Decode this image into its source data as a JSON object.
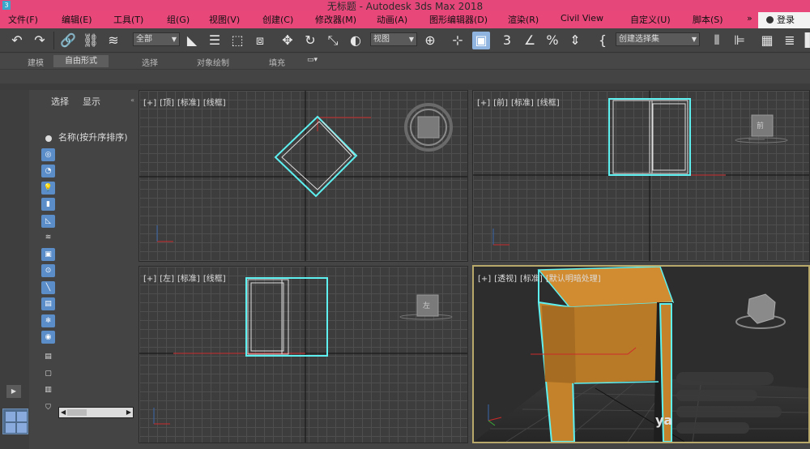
{
  "window": {
    "title": "无标题 - Autodesk 3ds Max 2018",
    "app_icon_label": "3"
  },
  "menu": {
    "items": [
      {
        "label": "文件(F)"
      },
      {
        "label": "编辑(E)"
      },
      {
        "label": "工具(T)"
      },
      {
        "label": "组(G)"
      },
      {
        "label": "视图(V)"
      },
      {
        "label": "创建(C)"
      },
      {
        "label": "修改器(M)"
      },
      {
        "label": "动画(A)"
      },
      {
        "label": "图形编辑器(D)"
      },
      {
        "label": "渲染(R)"
      },
      {
        "label": "Civil View"
      },
      {
        "label": "自定义(U)"
      },
      {
        "label": "脚本(S)"
      }
    ],
    "more_label": "»",
    "login_label": "登录"
  },
  "toolbar": {
    "icons": {
      "undo": "↶",
      "redo": "↷",
      "link": "🔗",
      "unlink": "⛓",
      "bind": "≋",
      "select": "◣",
      "select_by_name": "☰",
      "rect_region": "⬚",
      "window_crossing": "⧈",
      "move": "✥",
      "rotate": "↻",
      "scale": "⤡",
      "placement": "◐",
      "pivot": "⊕",
      "snap_toggle": "⊹",
      "manipulate": "▣",
      "snap3": "3",
      "angle_snap": "∠",
      "percent_snap": "%",
      "spinner_snap": "⇕",
      "edit_named": "{",
      "mirror": "⫴",
      "align": "⊫",
      "layers": "▦",
      "ribbon_toggle": "≣",
      "extra": "▌"
    },
    "selection_filter": "全部",
    "reference_coord": "视图",
    "named_selection_placeholder": "创建选择集"
  },
  "ribbon": {
    "tabs": [
      {
        "label": "建模",
        "active": false
      },
      {
        "label": "自由形式",
        "active": true
      },
      {
        "label": "选择",
        "active": false
      },
      {
        "label": "对象绘制",
        "active": false
      },
      {
        "label": "填充",
        "active": false
      }
    ],
    "dropdown_icon": "▭▾"
  },
  "scene_explorer": {
    "tabs": [
      {
        "label": "选择"
      },
      {
        "label": "显示"
      }
    ],
    "column_header": "名称(按升序排序)",
    "collapse_icon": "«",
    "filters": [
      {
        "name": "geometry-filter-icon",
        "glyph": "◎",
        "on": true
      },
      {
        "name": "shape-filter-icon",
        "glyph": "◔",
        "on": true
      },
      {
        "name": "light-filter-icon",
        "glyph": "💡",
        "on": true
      },
      {
        "name": "camera-filter-icon",
        "glyph": "▮",
        "on": true
      },
      {
        "name": "helper-filter-icon",
        "glyph": "◺",
        "on": true
      },
      {
        "name": "spacewarp-filter-icon",
        "glyph": "≋",
        "on": false
      },
      {
        "name": "group-filter-icon",
        "glyph": "▣",
        "on": true
      },
      {
        "name": "xref-filter-icon",
        "glyph": "⊙",
        "on": true
      },
      {
        "name": "bone-filter-icon",
        "glyph": "╲",
        "on": true
      },
      {
        "name": "container-filter-icon",
        "glyph": "▤",
        "on": true
      },
      {
        "name": "particle-filter-icon",
        "glyph": "❄",
        "on": true
      },
      {
        "name": "hidden-filter-icon",
        "glyph": "◉",
        "on": true
      },
      {
        "name": "list-a-icon",
        "glyph": "▤",
        "on": false
      },
      {
        "name": "list-b-icon",
        "glyph": "▢",
        "on": false
      },
      {
        "name": "list-c-icon",
        "glyph": "▥",
        "on": false
      },
      {
        "name": "filter-funnel-icon",
        "glyph": "⛉",
        "on": false
      }
    ],
    "expand_icon": "▶"
  },
  "viewports": {
    "top": {
      "labels": [
        "[+]",
        "[顶]",
        "[标准]",
        "[线框]"
      ]
    },
    "front": {
      "labels": [
        "[+]",
        "[前]",
        "[标准]",
        "[线框]"
      ],
      "viewcube_face": "前"
    },
    "left": {
      "labels": [
        "[+]",
        "[左]",
        "[标准]",
        "[线框]"
      ],
      "viewcube_face": "左"
    },
    "perspective": {
      "labels": [
        "[+]",
        "[透视]",
        "[标准]",
        "[默认明暗处理]"
      ],
      "watermark": "ya"
    }
  },
  "colors": {
    "title_bar": "#e5477a",
    "selection_highlight": "#5ef0f0",
    "object_orange": "#c88a2a",
    "active_viewport_border": "#b8a86a",
    "axis_x": "#cc2a2a"
  }
}
